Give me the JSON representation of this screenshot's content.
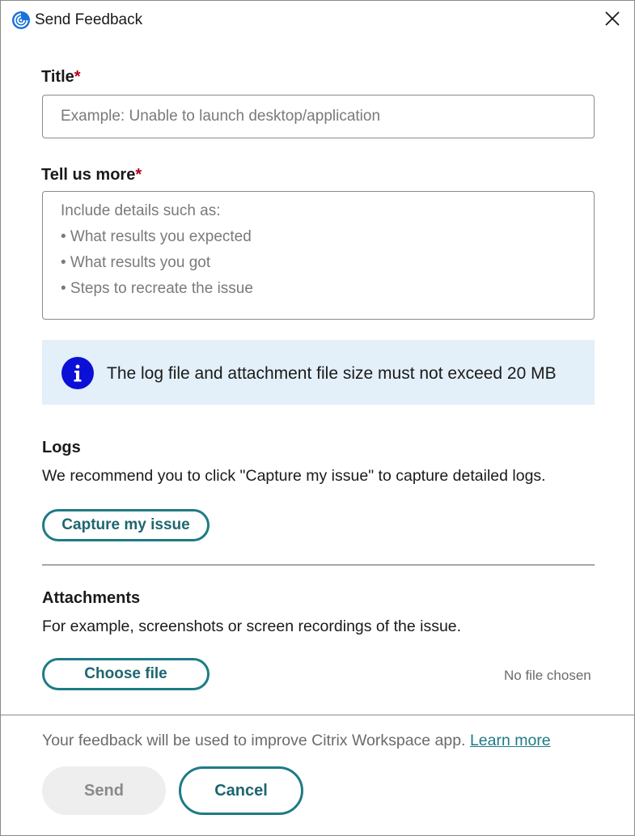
{
  "window": {
    "title": "Send Feedback",
    "app_icon": "citrix-workspace-icon",
    "close_icon": "close-icon"
  },
  "form": {
    "title_label": "Title",
    "required_mark": "*",
    "title_placeholder": "Example: Unable to launch desktop/application",
    "title_value": "",
    "details_label": "Tell us more",
    "details_placeholder_lines": [
      "Include details such as:",
      "• What results you expected",
      "• What results you got",
      "• Steps to recreate the issue"
    ]
  },
  "info": {
    "icon": "info-icon",
    "text": "The log file and attachment file size must not exceed 20 MB",
    "color": "#e3f0fa"
  },
  "logs": {
    "heading": "Logs",
    "description": "We recommend you to click \"Capture my issue\" to capture detailed logs.",
    "button_label": "Capture my issue"
  },
  "attachments": {
    "heading": "Attachments",
    "description": "For example, screenshots or screen recordings of the issue.",
    "button_label": "Choose file",
    "status": "No file chosen"
  },
  "footer": {
    "note": "Your feedback will be used to improve Citrix Workspace app.",
    "learn_more": "Learn more",
    "send_label": "Send",
    "cancel_label": "Cancel"
  },
  "colors": {
    "accent": "#1e7b86",
    "required": "#b3001b",
    "info_icon": "#0c10d6"
  }
}
